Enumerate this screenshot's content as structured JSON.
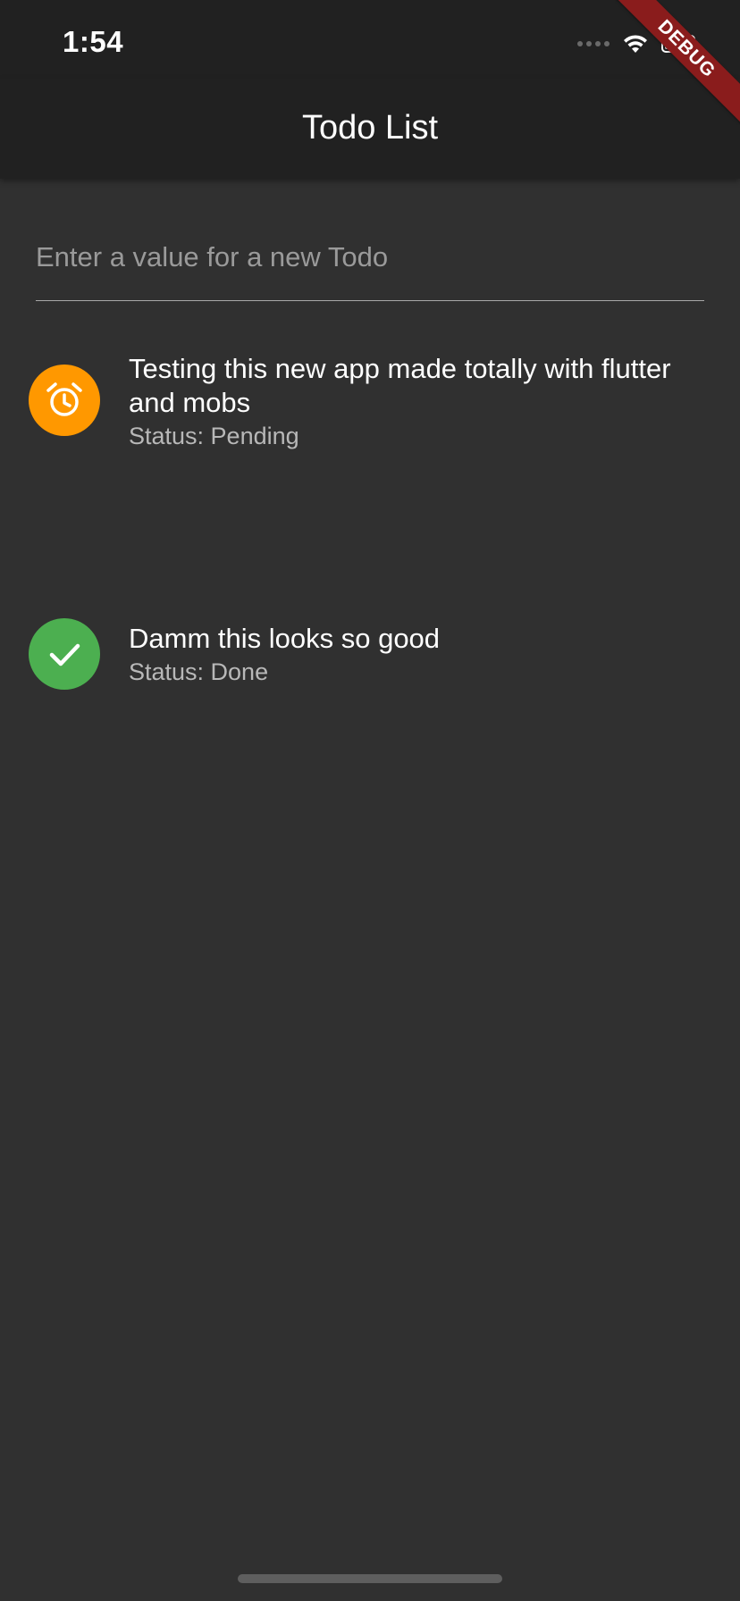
{
  "status_bar": {
    "time": "1:54"
  },
  "app_bar": {
    "title": "Todo List"
  },
  "debug_banner": {
    "label": "DEBUG"
  },
  "new_todo": {
    "placeholder": "Enter a value for a new Todo",
    "value": ""
  },
  "todos": [
    {
      "title": "Testing this new app made totally with flutter and mobs",
      "status": "Status: Pending",
      "icon": "alarm-clock-icon",
      "color": "#ff9800"
    },
    {
      "title": "Damm this looks so good",
      "status": "Status: Done",
      "icon": "checkmark-icon",
      "color": "#4caf50"
    }
  ],
  "colors": {
    "background": "#303030",
    "app_bar": "#212121",
    "pending": "#ff9800",
    "done": "#4caf50",
    "debug": "#8a1c1c"
  }
}
